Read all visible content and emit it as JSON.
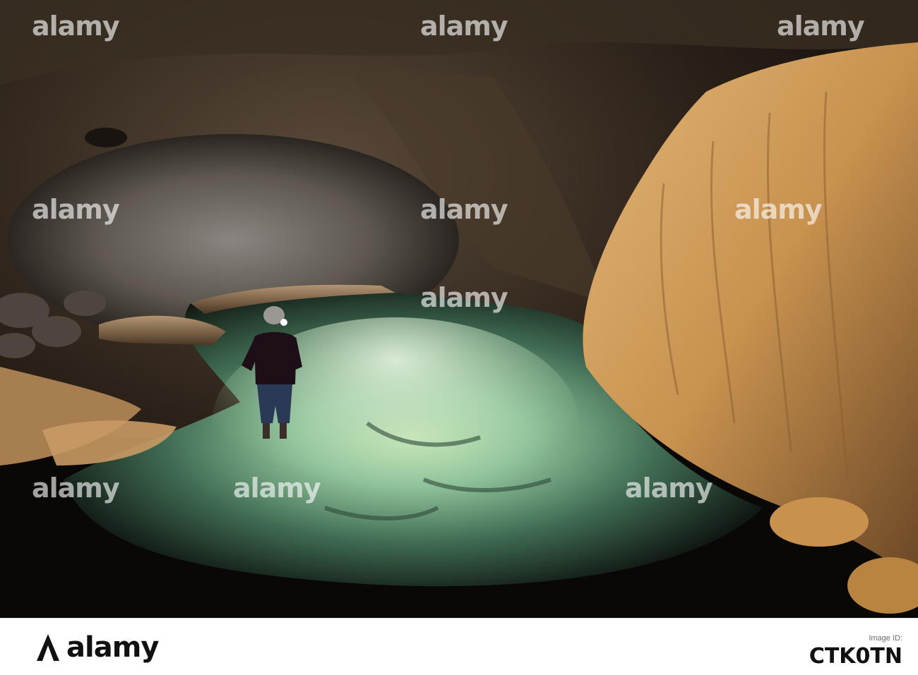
{
  "watermark": {
    "text": "alamy"
  },
  "footer": {
    "brand": "alamy",
    "image_id_label": "Image ID:",
    "image_id": "CTK0TN"
  },
  "icons": {
    "watermark_mark": "alamy-logo-icon",
    "footer_mark": "alamy-logo-icon"
  },
  "colors": {
    "water_glow": "#9fd0a0",
    "flowstone": "#c99a5c",
    "cave_dark": "#0d0a07"
  }
}
